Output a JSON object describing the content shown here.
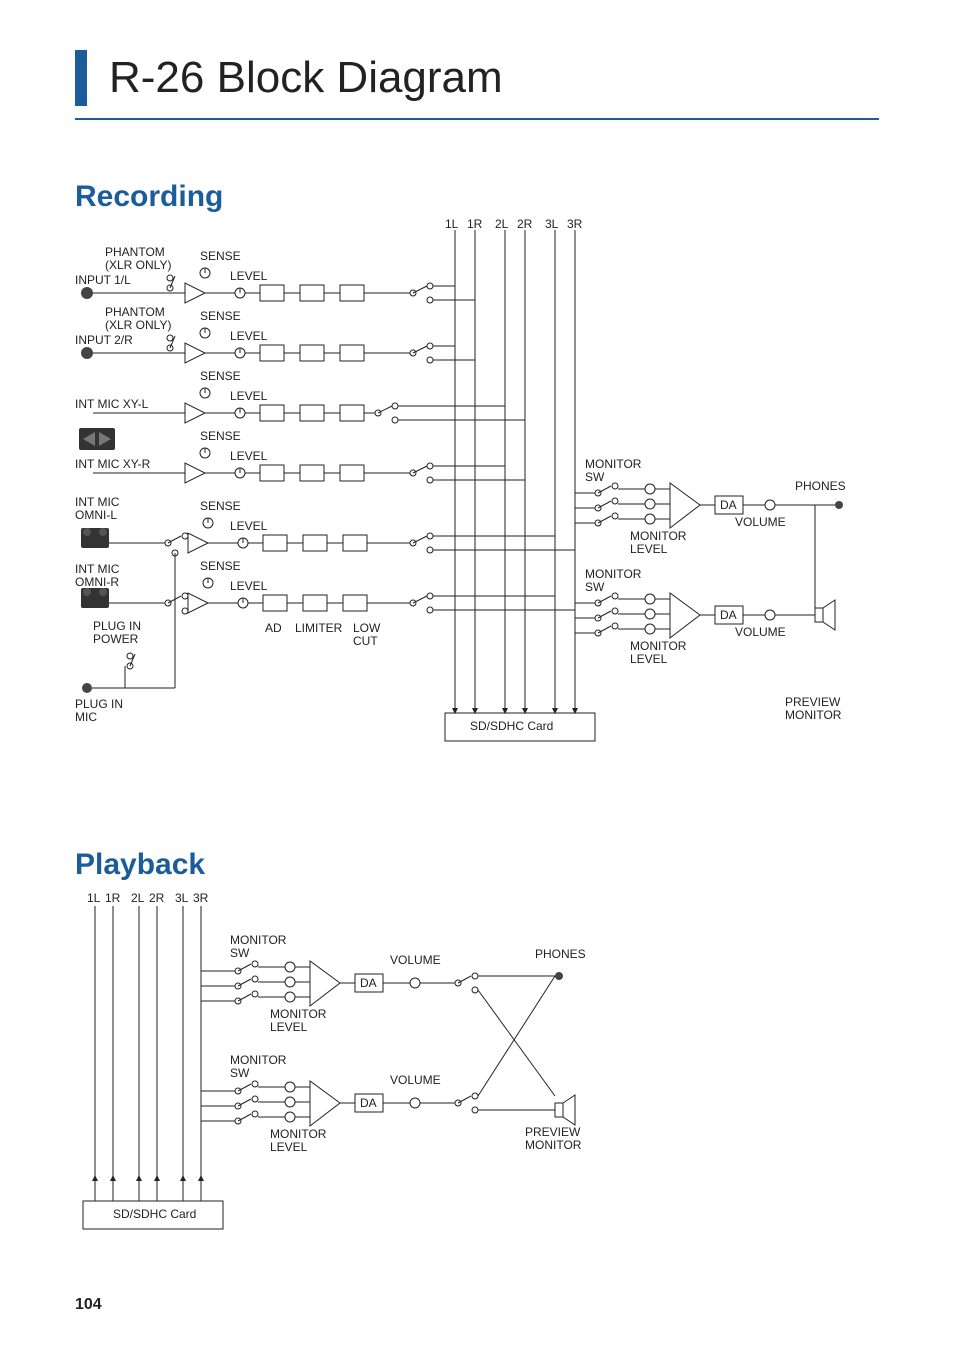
{
  "page": {
    "title": "R-26 Block Diagram",
    "number": "104"
  },
  "sections": {
    "recording": {
      "title": "Recording"
    },
    "playback": {
      "title": "Playback"
    }
  },
  "recording": {
    "channels": [
      "1L",
      "1R",
      "2L",
      "2R",
      "3L",
      "3R"
    ],
    "inputs": {
      "input1L": {
        "label": "INPUT 1/L",
        "phantom": "PHANTOM\n(XLR ONLY)",
        "sense": "SENSE",
        "level": "LEVEL"
      },
      "input2R": {
        "label": "INPUT 2/R",
        "phantom": "PHANTOM\n(XLR ONLY)",
        "sense": "SENSE",
        "level": "LEVEL"
      },
      "xyL": {
        "label": "INT MIC XY-L",
        "sense": "SENSE",
        "level": "LEVEL"
      },
      "xyR": {
        "label": "INT MIC XY-R",
        "sense": "SENSE",
        "level": "LEVEL"
      },
      "omniL": {
        "label": "INT MIC\nOMNI-L",
        "sense": "SENSE",
        "level": "LEVEL"
      },
      "omniR": {
        "label": "INT MIC\nOMNI-R",
        "sense": "SENSE",
        "level": "LEVEL"
      },
      "plugMic": {
        "label": "PLUG IN\nMIC",
        "power": "PLUG IN\nPOWER"
      }
    },
    "stages": {
      "ad": "AD",
      "limiter": "LIMITER",
      "lowcut": "LOW\nCUT"
    },
    "monitor": {
      "sw": "MONITOR\nSW",
      "level": "MONITOR\nLEVEL",
      "da": "DA",
      "volume": "VOLUME",
      "phones": "PHONES",
      "preview": "PREVIEW\nMONITOR"
    },
    "card": "SD/SDHC Card"
  },
  "playback": {
    "channels": [
      "1L",
      "1R",
      "2L",
      "2R",
      "3L",
      "3R"
    ],
    "monitor": {
      "sw": "MONITOR\nSW",
      "level": "MONITOR\nLEVEL",
      "da": "DA",
      "volume": "VOLUME",
      "phones": "PHONES",
      "preview": "PREVIEW\nMONITOR"
    },
    "card": "SD/SDHC Card"
  }
}
